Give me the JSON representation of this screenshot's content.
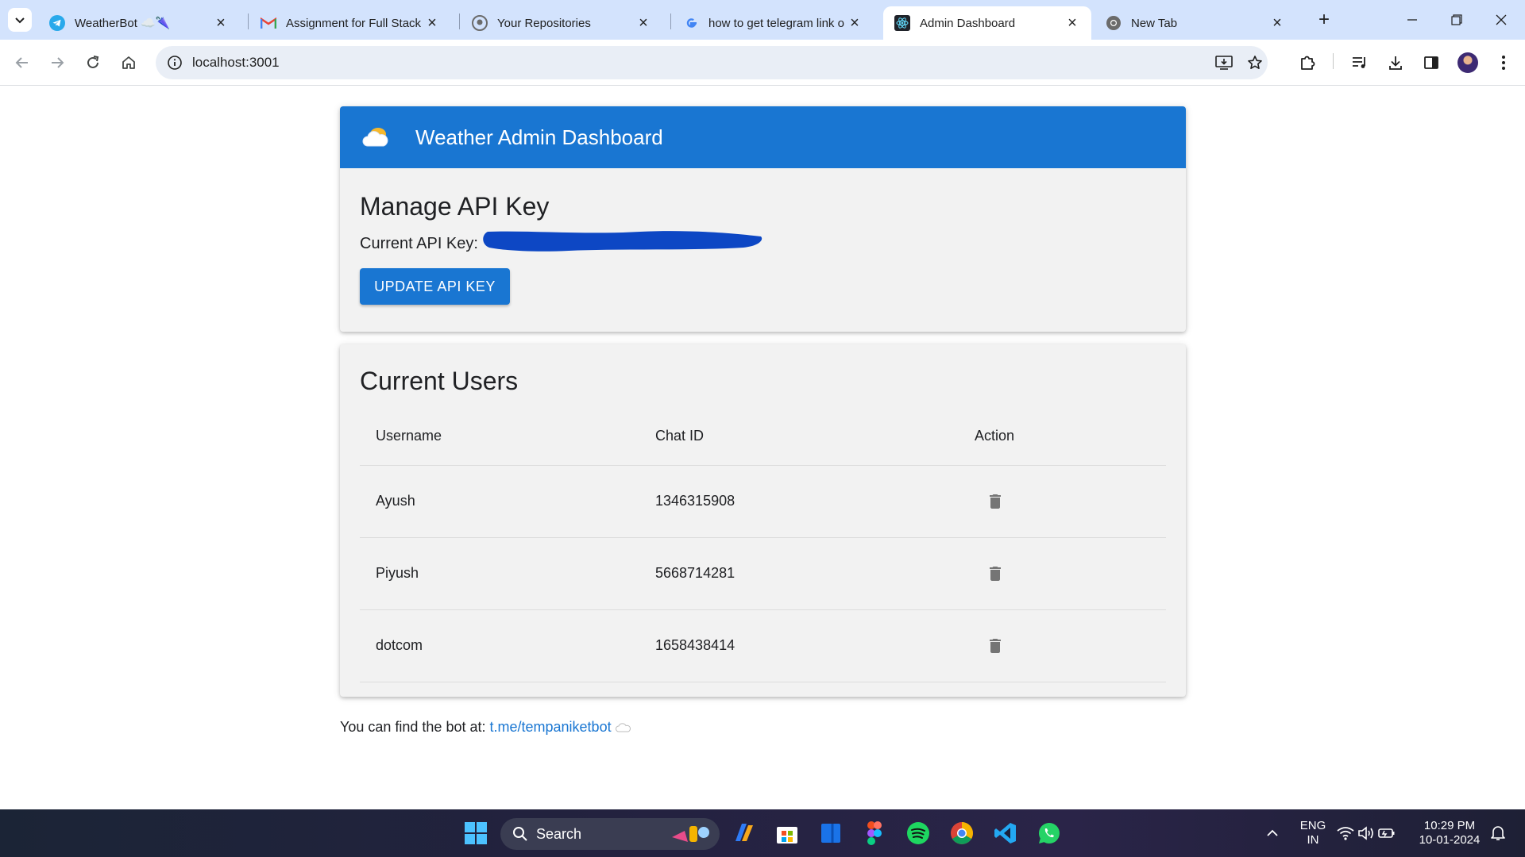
{
  "browser": {
    "tabs": [
      {
        "title": "WeatherBot ☁️🌂",
        "icon": "telegram-icon",
        "active": false
      },
      {
        "title": "Assignment for Full Stack D",
        "icon": "gmail-icon",
        "active": false
      },
      {
        "title": "Your Repositories",
        "icon": "github-icon",
        "active": false
      },
      {
        "title": "how to get telegram link o",
        "icon": "google-icon",
        "active": false
      },
      {
        "title": "Admin Dashboard",
        "icon": "react-icon",
        "active": true
      },
      {
        "title": "New Tab",
        "icon": "chrome-icon",
        "active": false
      }
    ],
    "address": "localhost:3001",
    "colors": {
      "tabstrip": "#d3e3fd",
      "omnibox": "#e9eef6"
    }
  },
  "app": {
    "title": "Weather Admin Dashboard",
    "logo_icon": "cloud-icon",
    "accent": "#1976d2",
    "api_section": {
      "heading": "Manage API Key",
      "current_label": "Current API Key:",
      "update_button": "UPDATE API KEY"
    },
    "users_section": {
      "heading": "Current Users",
      "columns": [
        "Username",
        "Chat ID",
        "Action"
      ],
      "rows": [
        {
          "username": "Ayush",
          "chat_id": "1346315908"
        },
        {
          "username": "Piyush",
          "chat_id": "5668714281"
        },
        {
          "username": "dotcom",
          "chat_id": "1658438414"
        }
      ],
      "action_icon": "trash-icon"
    },
    "footer": {
      "text": "You can find the bot at:",
      "link": "t.me/tempaniketbot"
    }
  },
  "taskbar": {
    "search_label": "Search",
    "language": "ENG",
    "region": "IN",
    "time": "10:29 PM",
    "date": "10-01-2024"
  }
}
